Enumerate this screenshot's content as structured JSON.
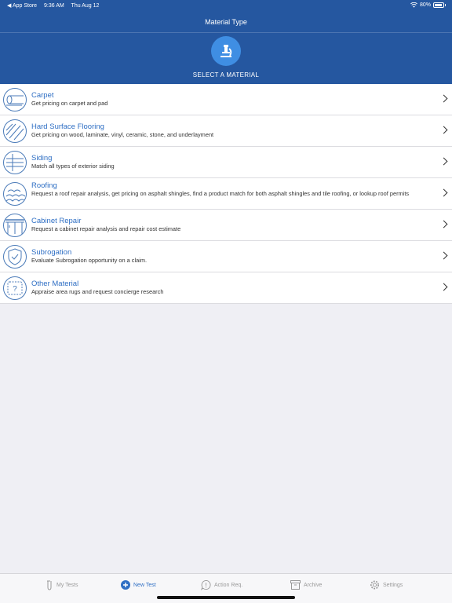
{
  "status_bar": {
    "back_app": "◀ App Store",
    "time": "9:36 AM",
    "date": "Thu Aug 12",
    "battery": "80%"
  },
  "header": {
    "title": "Material Type",
    "subtitle": "SELECT A MATERIAL",
    "icon": "microscope-icon"
  },
  "materials": [
    {
      "title": "Carpet",
      "description": "Get pricing on carpet and pad",
      "icon": "carpet-roll-icon"
    },
    {
      "title": "Hard Surface Flooring",
      "description": "Get pricing on wood, laminate, vinyl, ceramic, stone, and underlayment",
      "icon": "flooring-icon"
    },
    {
      "title": "Siding",
      "description": "Match all types of exterior siding",
      "icon": "siding-icon"
    },
    {
      "title": "Roofing",
      "description": "Request a roof repair analysis, get pricing on asphalt shingles, find a product match for both asphalt shingles and tile roofing, or lookup roof permits",
      "icon": "roof-shingles-icon"
    },
    {
      "title": "Cabinet Repair",
      "description": "Request a cabinet repair analysis and repair cost estimate",
      "icon": "cabinet-icon"
    },
    {
      "title": "Subrogation",
      "description": "Evaluate Subrogation opportunity on a claim.",
      "icon": "shield-check-icon"
    },
    {
      "title": "Other Material",
      "description": "Appraise area rugs and request concierge research",
      "icon": "question-rug-icon"
    }
  ],
  "tab_bar": {
    "tabs": [
      {
        "label": "My Tests",
        "icon": "test-tube-icon",
        "active": false
      },
      {
        "label": "New Test",
        "icon": "plus-circle-icon",
        "active": true
      },
      {
        "label": "Action Req.",
        "icon": "alert-bubble-icon",
        "active": false
      },
      {
        "label": "Archive",
        "icon": "archive-box-icon",
        "active": false
      },
      {
        "label": "Settings",
        "icon": "gear-icon",
        "active": false
      }
    ]
  },
  "colors": {
    "header_bg": "#2557a0",
    "accent": "#2f6fc4",
    "icon_circle": "#3f8ee3"
  }
}
